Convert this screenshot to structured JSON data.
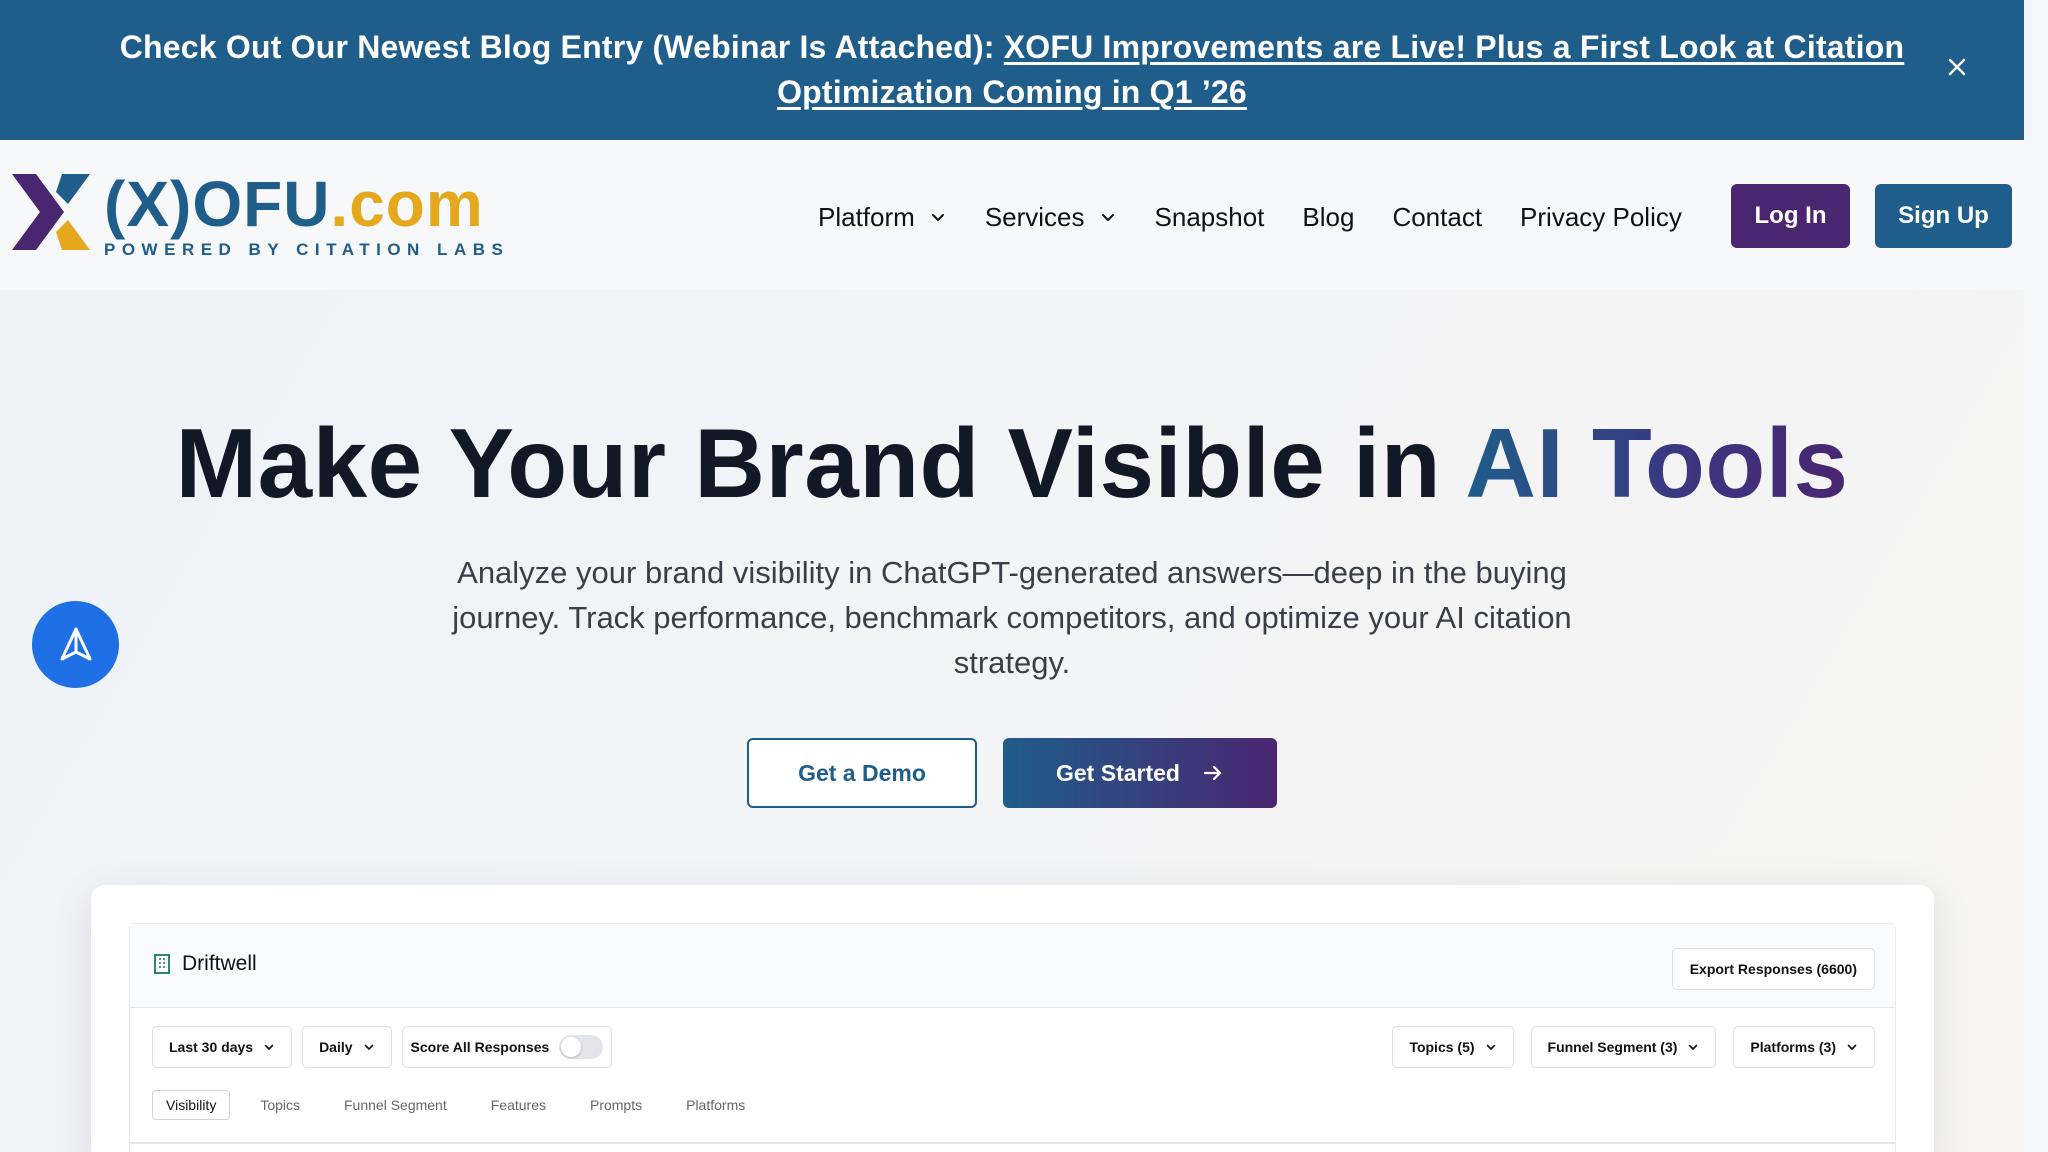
{
  "banner": {
    "lead_text": "Check Out Our Newest Blog Entry (Webinar Is Attached):",
    "link_text": "XOFU Improvements are Live! Plus a First Look at Citation Optimization Coming in Q1 ’26",
    "close_icon": "close-icon"
  },
  "header": {
    "logo": {
      "wordmark_main": "(X)OFU",
      "wordmark_suffix": ".com",
      "tagline": "POWERED BY CITATION LABS"
    },
    "nav": [
      {
        "label": "Platform",
        "has_dropdown": true
      },
      {
        "label": "Services",
        "has_dropdown": true
      },
      {
        "label": "Snapshot",
        "has_dropdown": false
      },
      {
        "label": "Blog",
        "has_dropdown": false
      },
      {
        "label": "Contact",
        "has_dropdown": false
      },
      {
        "label": "Privacy Policy",
        "has_dropdown": false
      }
    ],
    "login_label": "Log In",
    "signup_label": "Sign Up"
  },
  "hero": {
    "title_main": "Make Your Brand Visible in ",
    "title_accent": "AI Tools",
    "subtitle": "Analyze your brand visibility in ChatGPT-generated answers—deep in the buying journey. Track performance, benchmark competitors, and optimize your AI citation strategy.",
    "demo_label": "Get a Demo",
    "start_label": "Get Started"
  },
  "fab": {
    "icon": "send-arrow-icon"
  },
  "dashboard": {
    "brand_name": "Driftwell",
    "export_label": "Export Responses (6600)",
    "filters_left": {
      "range": "Last 30 days",
      "interval": "Daily",
      "score_all_label": "Score All Responses",
      "score_all_on": false
    },
    "filters_right": [
      "Topics (5)",
      "Funnel Segment (3)",
      "Platforms (3)"
    ],
    "tabs": [
      {
        "label": "Visibility",
        "active": true
      },
      {
        "label": "Topics",
        "active": false
      },
      {
        "label": "Funnel Segment",
        "active": false
      },
      {
        "label": "Features",
        "active": false
      },
      {
        "label": "Prompts",
        "active": false
      },
      {
        "label": "Platforms",
        "active": false
      }
    ]
  },
  "colors": {
    "brand_blue": "#1f5d8a",
    "brand_purple": "#4a2670",
    "brand_gold": "#e5a81c",
    "fab_blue": "#1f6fe5"
  }
}
